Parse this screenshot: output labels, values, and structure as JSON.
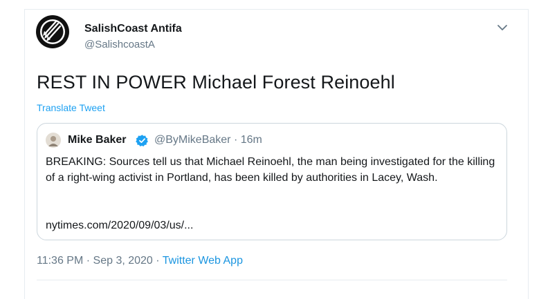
{
  "author": {
    "display_name": "SalishCoast Antifa",
    "handle": "@SalishcoastA",
    "avatar_icon": "antifa-three-arrows-logo"
  },
  "tweet": {
    "text": "REST IN POWER Michael Forest Reinoehl",
    "translate_label": "Translate Tweet"
  },
  "quoted_tweet": {
    "display_name": "Mike Baker",
    "handle_time": "@ByMikeBaker · 16m",
    "verified": true,
    "text": "BREAKING: Sources tell us that Michael Reinoehl, the man being investigated for the killing of a right-wing activist in Portland, has been killed by authorities in Lacey, Wash.",
    "link": "nytimes.com/2020/09/03/us/..."
  },
  "meta": {
    "time": "11:36 PM",
    "date": "Sep 3, 2020",
    "separator": "·",
    "app": "Twitter Web App"
  },
  "colors": {
    "accent": "#1da1f2",
    "secondary_text": "#657786",
    "border": "#ccd6dd"
  }
}
